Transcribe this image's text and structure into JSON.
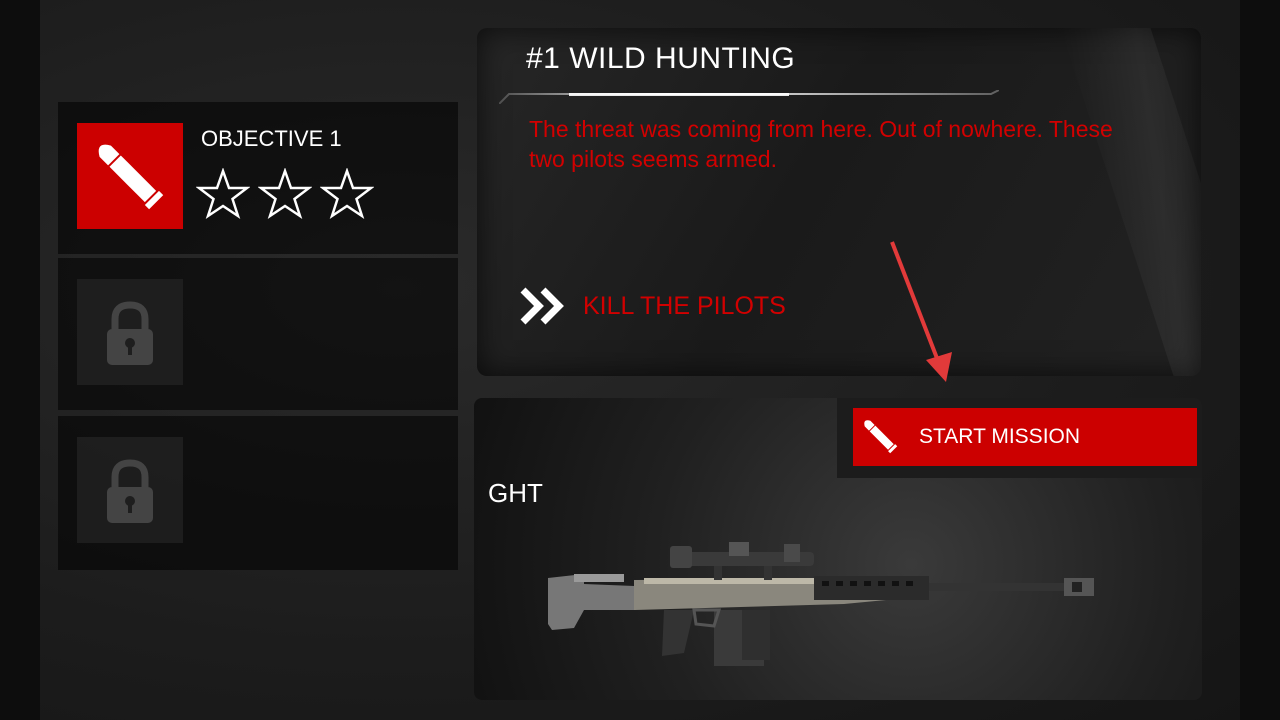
{
  "objectives": [
    {
      "title": "OBJECTIVE 1",
      "locked": false,
      "stars_earned": 0,
      "stars_total": 3,
      "icon": "bullet-icon"
    },
    {
      "locked": true,
      "icon": "lock-icon"
    },
    {
      "locked": true,
      "icon": "lock-icon"
    }
  ],
  "mission": {
    "title": "#1 WILD HUNTING",
    "description": "The threat was coming from here. Out of nowhere. These two pilots seems armed.",
    "task": "KILL THE PILOTS",
    "task_icon": "double-chevron-icon"
  },
  "weapon": {
    "name": "GHT"
  },
  "start_button": {
    "label": "START MISSION",
    "icon": "bullet-icon"
  },
  "colors": {
    "accent": "#cc0000",
    "text_red": "#d20000",
    "annotation_arrow": "#e23a3a"
  }
}
